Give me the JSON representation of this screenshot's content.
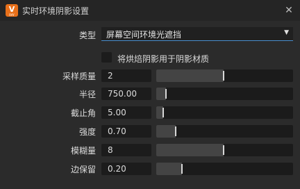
{
  "window": {
    "app_icon_letter": "V",
    "app_icon_sub": "RAY",
    "title": "实时环境阴影设置",
    "close_glyph": "✕"
  },
  "type_field": {
    "label": "类型",
    "value": "屏幕空间环境光遮挡",
    "arrow_glyph": "▼"
  },
  "bake_option": {
    "label": "将烘焙阴影用于阴影材质",
    "checked": false
  },
  "params": [
    {
      "label": "采样质量",
      "value": "2",
      "fraction": 0.49
    },
    {
      "label": "半径",
      "value": "750.00",
      "fraction": 0.07
    },
    {
      "label": "截止角",
      "value": "5.00",
      "fraction": 0.05
    },
    {
      "label": "强度",
      "value": "0.70",
      "fraction": 0.14
    },
    {
      "label": "模糊量",
      "value": "8",
      "fraction": 0.49
    },
    {
      "label": "边保留",
      "value": "0.20",
      "fraction": 0.19
    }
  ],
  "colors": {
    "accent": "#4a8fd0",
    "icon": "#e8701a"
  }
}
